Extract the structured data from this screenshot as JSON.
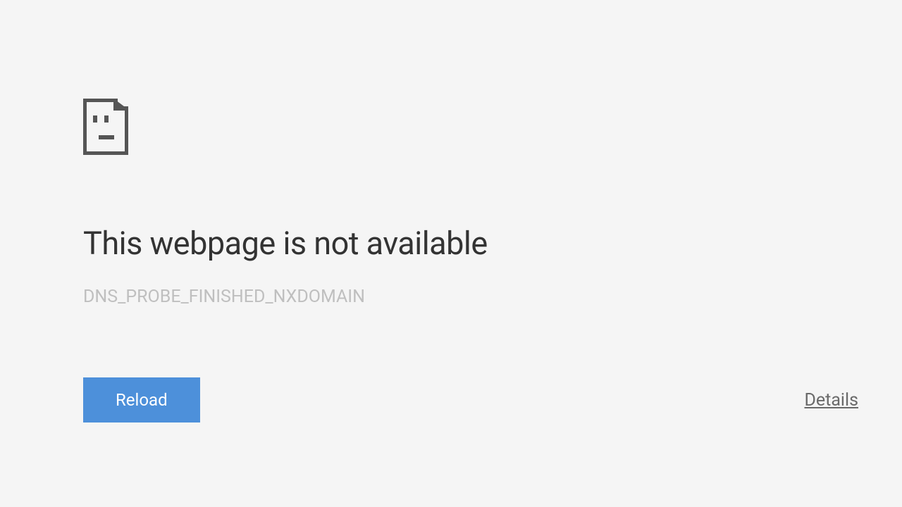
{
  "error": {
    "heading": "This webpage is not available",
    "code": "DNS_PROBE_FINISHED_NXDOMAIN"
  },
  "actions": {
    "reload_label": "Reload",
    "details_label": "Details"
  },
  "icon": {
    "name": "sad-page-icon"
  }
}
